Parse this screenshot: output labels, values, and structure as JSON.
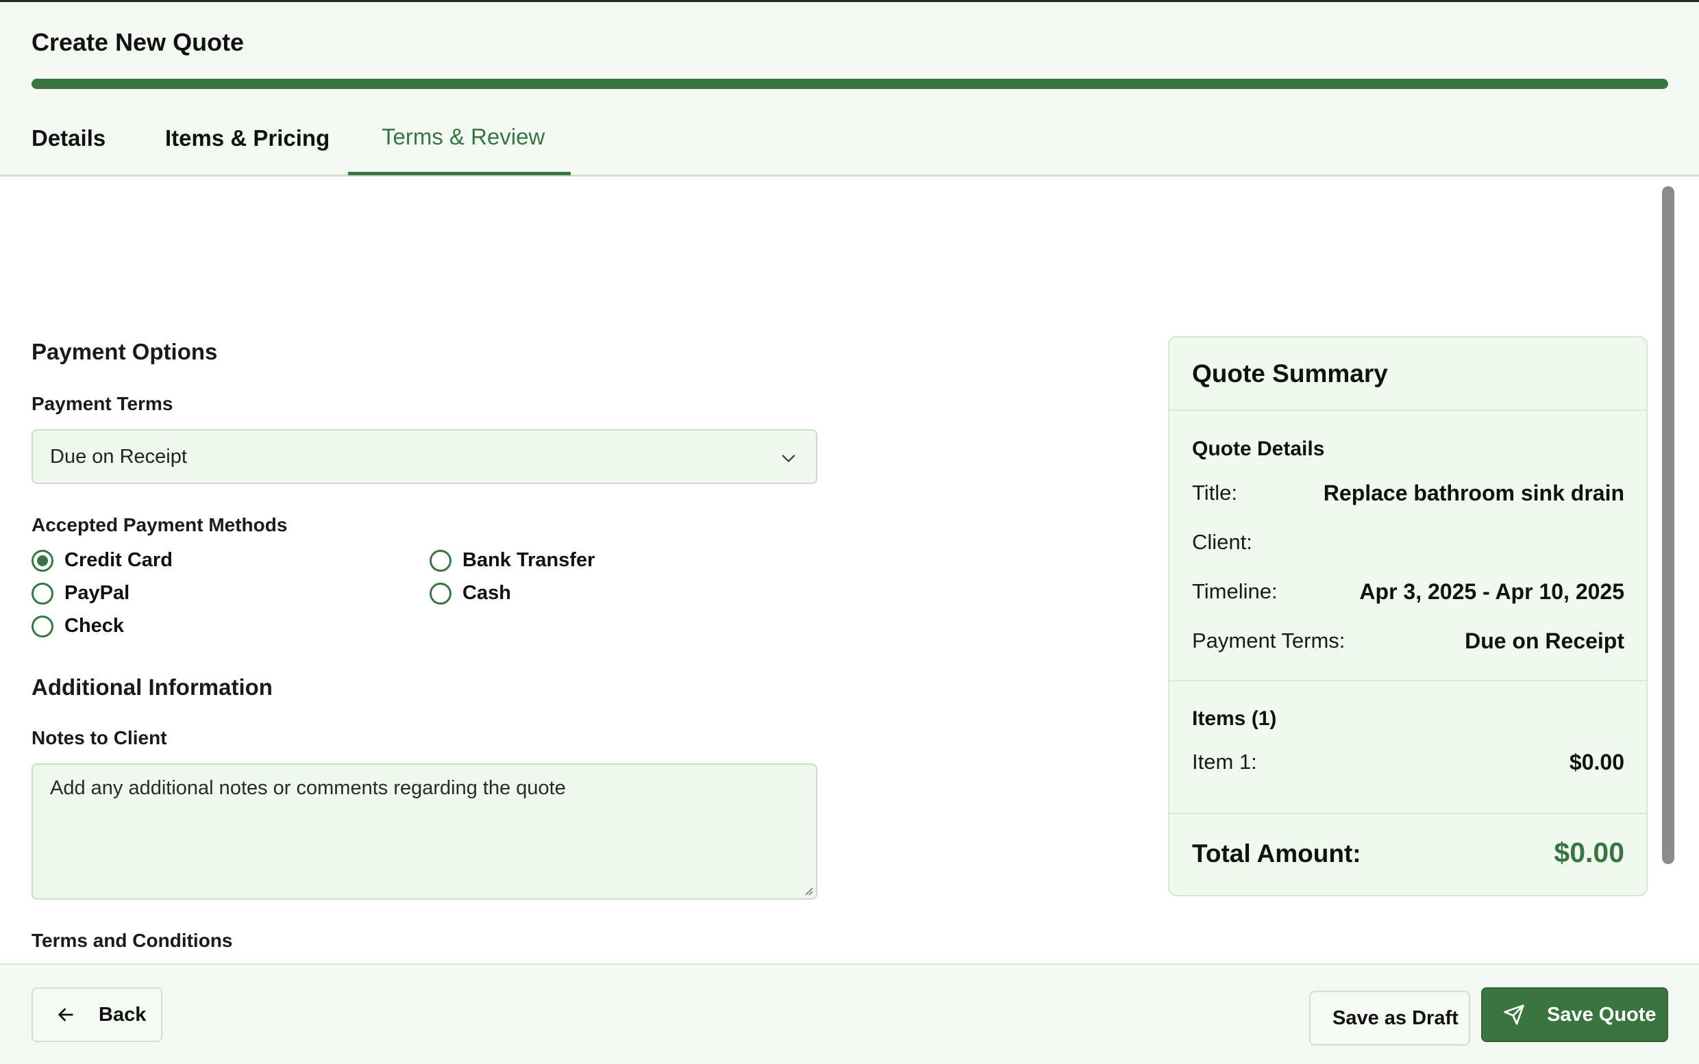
{
  "header": {
    "title": "Create New Quote",
    "progress": 1.0,
    "tabs": [
      {
        "label": "Details",
        "active": false
      },
      {
        "label": "Items & Pricing",
        "active": false
      },
      {
        "label": "Terms & Review",
        "active": true
      }
    ]
  },
  "payment": {
    "heading": "Payment Options",
    "terms_label": "Payment Terms",
    "terms_value": "Due on Receipt",
    "methods_label": "Accepted Payment Methods",
    "methods": [
      {
        "label": "Credit Card",
        "checked": true
      },
      {
        "label": "Bank Transfer",
        "checked": false
      },
      {
        "label": "PayPal",
        "checked": false
      },
      {
        "label": "Cash",
        "checked": false
      },
      {
        "label": "Check",
        "checked": false
      }
    ]
  },
  "additional": {
    "heading": "Additional Information",
    "notes_label": "Notes to Client",
    "notes_placeholder": "Add any additional notes or comments regarding the quote",
    "terms_label": "Terms and Conditions"
  },
  "summary": {
    "title": "Quote Summary",
    "details_heading": "Quote Details",
    "rows": [
      {
        "label": "Title:",
        "value": "Replace bathroom sink drain"
      },
      {
        "label": "Client:",
        "value": ""
      },
      {
        "label": "Timeline:",
        "value": "Apr 3, 2025 - Apr 10, 2025"
      },
      {
        "label": "Payment Terms:",
        "value": "Due on Receipt"
      }
    ],
    "items_heading": "Items (1)",
    "items": [
      {
        "label": "Item 1:",
        "value": "$0.00"
      }
    ],
    "total_label": "Total Amount:",
    "total_value": "$0.00"
  },
  "footer": {
    "back_label": "Back",
    "draft_label": "Save as Draft",
    "save_label": "Save Quote"
  },
  "colors": {
    "accent": "#3a7440",
    "background": "#f4f9f3",
    "field_background": "#eff7ee"
  },
  "icons": [
    "chevron-down-icon",
    "arrow-left-icon",
    "send-icon"
  ]
}
